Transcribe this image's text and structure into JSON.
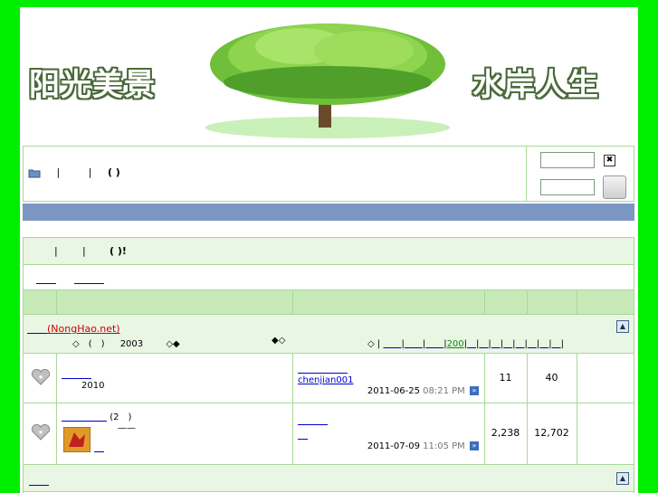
{
  "banner": {
    "left_text": "阳光美景",
    "right_text": "水岸人生"
  },
  "topbar": {
    "sep1": "|",
    "sep2": "|",
    "paren": "(          )"
  },
  "welcome": {
    "sep1": "|",
    "sep2": "|",
    "paren": "(          )!"
  },
  "links": {
    "link1": "　　",
    "link2": "　　　"
  },
  "category": {
    "site_name": "(NongHao.net)",
    "site_prefix": "　　",
    "line2_a": "◇　(　)",
    "line2_year": "2003",
    "line2_b": "◇◆",
    "line2_c": "◆◇",
    "pager_prefix": "◇ |",
    "pages": [
      "　　",
      "　　",
      "　　",
      "200",
      "　",
      "　",
      "　",
      "　",
      "　",
      "　",
      "　",
      "　"
    ],
    "pages_sep": "|"
  },
  "forums": [
    {
      "name": "　　　",
      "desc": "2010",
      "last_title": "　　　　　",
      "last_user": "chenjian001",
      "last_date": "2011-06-25",
      "last_time": "08:21 PM",
      "topics": "11",
      "posts": "40"
    },
    {
      "name": "　　　　　",
      "name_suffix": "(2　)",
      "mod_text": "——",
      "sub_link": "　",
      "last_title": "　　　",
      "last_user": "　",
      "last_date": "2011-07-09",
      "last_time": "11:05 PM",
      "topics": "2,238",
      "posts": "12,702"
    }
  ],
  "category2": {
    "title": "　　"
  },
  "colors": {
    "page_bg": "#00ee00",
    "border": "#a8d898",
    "header_row": "#c8eab8",
    "light_row": "#eaf6e4",
    "navbar": "#7b97c4"
  }
}
